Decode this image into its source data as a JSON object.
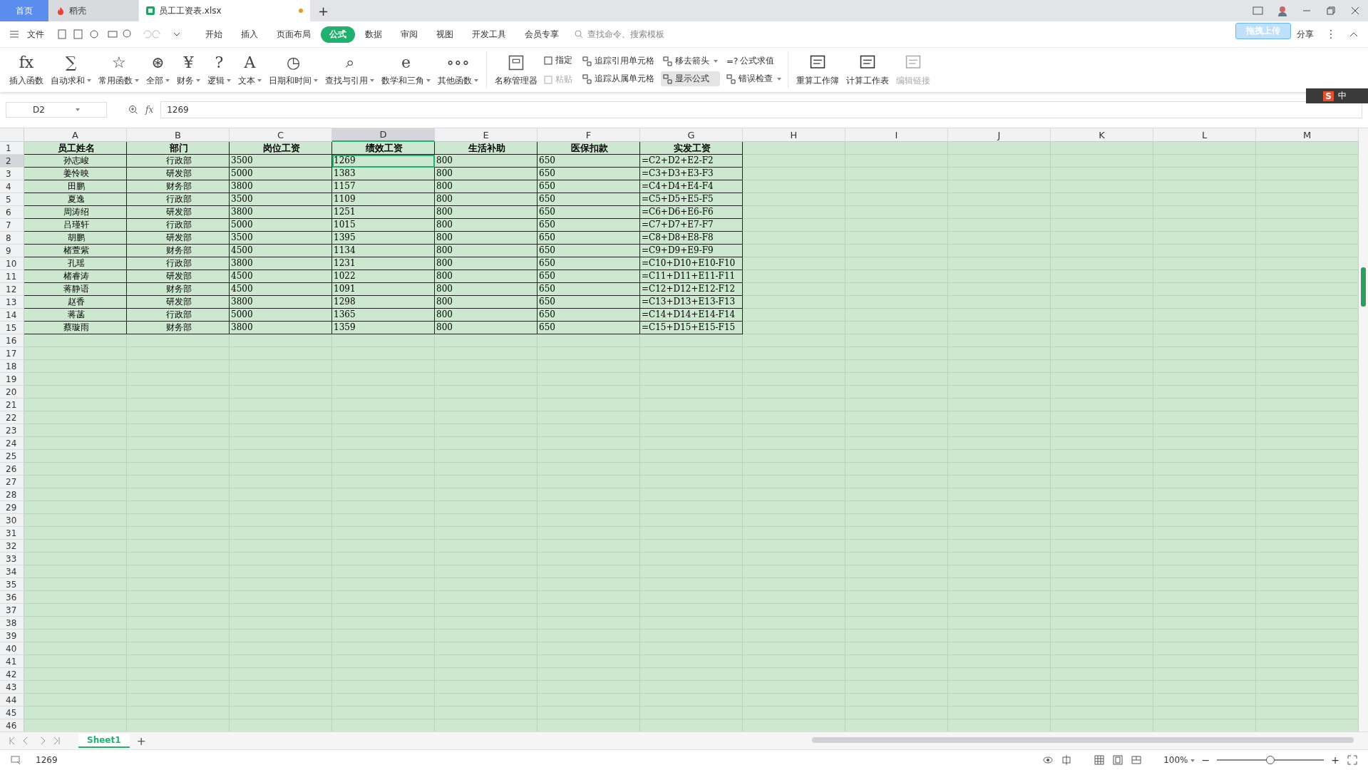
{
  "title_tabs": [
    {
      "label": "首页",
      "kind": "home",
      "selected": false,
      "modified": false
    },
    {
      "label": "稻壳",
      "kind": "docer",
      "selected": false,
      "modified": false
    },
    {
      "label": "员工工资表.xlsx",
      "kind": "sheet",
      "selected": true,
      "modified": true
    }
  ],
  "new_tab": "+",
  "menu": {
    "file": "文件",
    "tabs": [
      {
        "label": "开始",
        "selected": false
      },
      {
        "label": "插入",
        "selected": false
      },
      {
        "label": "页面布局",
        "selected": false
      },
      {
        "label": "公式",
        "selected": true
      },
      {
        "label": "数据",
        "selected": false
      },
      {
        "label": "审阅",
        "selected": false
      },
      {
        "label": "视图",
        "selected": false
      },
      {
        "label": "开发工具",
        "selected": false
      },
      {
        "label": "会员专享",
        "selected": false
      }
    ],
    "search": {
      "placeholder": "查找命令、搜索模板"
    },
    "upload": "拖拽上传",
    "share": "分享"
  },
  "ribbon": {
    "functions": [
      {
        "label": "插入函数",
        "glyph": "fx",
        "dropdown": false
      },
      {
        "label": "自动求和",
        "glyph": "∑",
        "dropdown": true
      },
      {
        "label": "常用函数",
        "glyph": "☆",
        "dropdown": true
      },
      {
        "label": "全部",
        "glyph": "⊛",
        "dropdown": true
      },
      {
        "label": "财务",
        "glyph": "¥",
        "dropdown": true
      },
      {
        "label": "逻辑",
        "glyph": "?",
        "dropdown": true
      },
      {
        "label": "文本",
        "glyph": "A",
        "dropdown": true
      },
      {
        "label": "日期和时间",
        "glyph": "◷",
        "dropdown": true
      },
      {
        "label": "查找与引用",
        "glyph": "⌕",
        "dropdown": true
      },
      {
        "label": "数学和三角",
        "glyph": "e",
        "dropdown": true
      },
      {
        "label": "其他函数",
        "glyph": "∘∘∘",
        "dropdown": true
      }
    ],
    "names": {
      "label": "名称管理器",
      "small": [
        {
          "label": "指定",
          "disabled": false
        },
        {
          "label": "粘贴",
          "disabled": true
        }
      ]
    },
    "audit": [
      {
        "label": "追踪引用单元格",
        "dropdown": false,
        "pressed": false
      },
      {
        "label": "追踪从属单元格",
        "dropdown": false,
        "pressed": false
      },
      {
        "label": "移去箭头",
        "dropdown": true,
        "pressed": false
      },
      {
        "label": "显示公式",
        "dropdown": false,
        "pressed": true
      },
      {
        "label": "公式求值",
        "glyph": "=?",
        "dropdown": false,
        "pressed": false
      },
      {
        "label": "错误检查",
        "dropdown": true,
        "pressed": false
      }
    ],
    "calc": [
      {
        "label": "重算工作簿",
        "disabled": false
      },
      {
        "label": "计算工作表",
        "disabled": false
      },
      {
        "label": "编辑链接",
        "disabled": true
      }
    ]
  },
  "ime": {
    "logo": "S",
    "mode": "中"
  },
  "formula_bar": {
    "name_box": "D2",
    "fx": "fx",
    "value": "1269"
  },
  "sheet": {
    "columns": [
      {
        "label": "A",
        "selected": false
      },
      {
        "label": "B",
        "selected": false
      },
      {
        "label": "C",
        "selected": false
      },
      {
        "label": "D",
        "selected": true
      },
      {
        "label": "E",
        "selected": false
      },
      {
        "label": "F",
        "selected": false
      },
      {
        "label": "G",
        "selected": false
      },
      {
        "label": "H",
        "selected": false
      },
      {
        "label": "I",
        "selected": false
      },
      {
        "label": "J",
        "selected": false
      },
      {
        "label": "K",
        "selected": false
      },
      {
        "label": "L",
        "selected": false
      },
      {
        "label": "M",
        "selected": false
      }
    ],
    "rows": [
      {
        "number": "1",
        "selected": false,
        "cells": [
          "员工姓名",
          "部门",
          "岗位工资",
          "绩效工资",
          "生活补助",
          "医保扣款",
          "实发工资"
        ]
      },
      {
        "number": "2",
        "selected": true,
        "cells": [
          "孙志峻",
          "行政部",
          "3500",
          "1269",
          "800",
          "650",
          "=C2+D2+E2-F2"
        ]
      },
      {
        "number": "3",
        "selected": false,
        "cells": [
          "姜怜映",
          "研发部",
          "5000",
          "1383",
          "800",
          "650",
          "=C3+D3+E3-F3"
        ]
      },
      {
        "number": "4",
        "selected": false,
        "cells": [
          "田鹏",
          "财务部",
          "3800",
          "1157",
          "800",
          "650",
          "=C4+D4+E4-F4"
        ]
      },
      {
        "number": "5",
        "selected": false,
        "cells": [
          "夏逸",
          "行政部",
          "3500",
          "1109",
          "800",
          "650",
          "=C5+D5+E5-F5"
        ]
      },
      {
        "number": "6",
        "selected": false,
        "cells": [
          "周涛绍",
          "研发部",
          "3800",
          "1251",
          "800",
          "650",
          "=C6+D6+E6-F6"
        ]
      },
      {
        "number": "7",
        "selected": false,
        "cells": [
          "吕瑾轩",
          "行政部",
          "5000",
          "1015",
          "800",
          "650",
          "=C7+D7+E7-F7"
        ]
      },
      {
        "number": "8",
        "selected": false,
        "cells": [
          "胡鹏",
          "研发部",
          "3500",
          "1395",
          "800",
          "650",
          "=C8+D8+E8-F8"
        ]
      },
      {
        "number": "9",
        "selected": false,
        "cells": [
          "楮萱紫",
          "财务部",
          "4500",
          "1134",
          "800",
          "650",
          "=C9+D9+E9-F9"
        ]
      },
      {
        "number": "10",
        "selected": false,
        "cells": [
          "孔瑶",
          "行政部",
          "3800",
          "1231",
          "800",
          "650",
          "=C10+D10+E10-F10"
        ]
      },
      {
        "number": "11",
        "selected": false,
        "cells": [
          "楮睿涛",
          "研发部",
          "4500",
          "1022",
          "800",
          "650",
          "=C11+D11+E11-F11"
        ]
      },
      {
        "number": "12",
        "selected": false,
        "cells": [
          "蒋静语",
          "财务部",
          "4500",
          "1091",
          "800",
          "650",
          "=C12+D12+E12-F12"
        ]
      },
      {
        "number": "13",
        "selected": false,
        "cells": [
          "赵香",
          "研发部",
          "3800",
          "1298",
          "800",
          "650",
          "=C13+D13+E13-F13"
        ]
      },
      {
        "number": "14",
        "selected": false,
        "cells": [
          "蒋菡",
          "行政部",
          "5000",
          "1365",
          "800",
          "650",
          "=C14+D14+E14-F14"
        ]
      },
      {
        "number": "15",
        "selected": false,
        "cells": [
          "蔡璇雨",
          "财务部",
          "3800",
          "1359",
          "800",
          "650",
          "=C15+D15+E15-F15"
        ]
      },
      {
        "number": "16",
        "selected": false
      },
      {
        "number": "17",
        "selected": false
      },
      {
        "number": "18",
        "selected": false
      },
      {
        "number": "19",
        "selected": false
      },
      {
        "number": "20",
        "selected": false
      },
      {
        "number": "21",
        "selected": false
      },
      {
        "number": "22",
        "selected": false
      },
      {
        "number": "23",
        "selected": false
      },
      {
        "number": "24",
        "selected": false
      },
      {
        "number": "25",
        "selected": false
      },
      {
        "number": "26",
        "selected": false
      },
      {
        "number": "27",
        "selected": false
      },
      {
        "number": "28",
        "selected": false
      },
      {
        "number": "29",
        "selected": false
      },
      {
        "number": "30",
        "selected": false
      },
      {
        "number": "31",
        "selected": false
      },
      {
        "number": "32",
        "selected": false
      },
      {
        "number": "33",
        "selected": false
      },
      {
        "number": "34",
        "selected": false
      },
      {
        "number": "35",
        "selected": false
      },
      {
        "number": "36",
        "selected": false
      },
      {
        "number": "37",
        "selected": false
      },
      {
        "number": "38",
        "selected": false
      },
      {
        "number": "39",
        "selected": false
      },
      {
        "number": "40",
        "selected": false
      },
      {
        "number": "41",
        "selected": false
      },
      {
        "number": "42",
        "selected": false
      },
      {
        "number": "43",
        "selected": false
      },
      {
        "number": "44",
        "selected": false
      },
      {
        "number": "45",
        "selected": false
      },
      {
        "number": "46",
        "selected": false
      }
    ]
  },
  "sheet_tabs": [
    {
      "label": "Sheet1",
      "selected": true
    }
  ],
  "add_sheet": "+",
  "status_bar": {
    "value": "1269",
    "zoom": "100%",
    "zoom_slider": {
      "level": 0.5
    },
    "minus": "−",
    "plus": "+"
  }
}
